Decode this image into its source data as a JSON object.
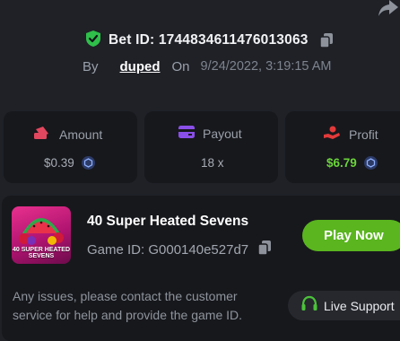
{
  "header": {
    "bet_id_label": "Bet ID: 1744834611476013063",
    "by_label": "By",
    "username": "duped",
    "on_label": "On",
    "date": "9/24/2022, 3:19:15 AM"
  },
  "stats": {
    "amount": {
      "label": "Amount",
      "value": "$0.39"
    },
    "payout": {
      "label": "Payout",
      "value": "18 x"
    },
    "profit": {
      "label": "Profit",
      "value": "$6.79"
    }
  },
  "game": {
    "title": "40 Super Heated Sevens",
    "game_id": "Game ID: G000140e527d7",
    "thumb_text": "40 SUPER HEATED SEVENS",
    "play_label": "Play Now"
  },
  "support": {
    "issues_text": "Any issues, please contact the customer service for help and provide the game ID.",
    "button_label": "Live Support"
  },
  "colors": {
    "background": "#1f2127",
    "card": "#17181c",
    "play_green": "#5ab51f",
    "profit_green": "#6bd43a",
    "shield_green": "#2fbf4a",
    "amount_icon": "#e2475f",
    "payout_icon": "#8a4fe8",
    "profit_icon": "#e23a3a"
  },
  "icons": [
    "share-icon",
    "shield-check-icon",
    "copy-icon",
    "amount-icon",
    "payout-icon",
    "profit-icon",
    "coin-icon",
    "headset-icon"
  ]
}
